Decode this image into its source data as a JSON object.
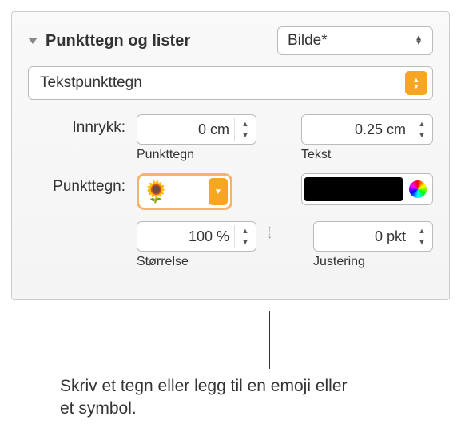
{
  "header": {
    "title": "Punkttegn og lister",
    "style_select": "Bilde*"
  },
  "type_select": "Tekstpunkttegn",
  "indent": {
    "label": "Innrykk:",
    "bullet_value": "0 cm",
    "bullet_caption": "Punkttegn",
    "text_value": "0.25 cm",
    "text_caption": "Tekst"
  },
  "bullet": {
    "label": "Punkttegn:",
    "glyph": "🌻",
    "size_value": "100 %",
    "size_caption": "Størrelse",
    "align_value": "0 pkt",
    "align_caption": "Justering"
  },
  "callout": "Skriv et tegn eller legg til en emoji eller et symbol."
}
